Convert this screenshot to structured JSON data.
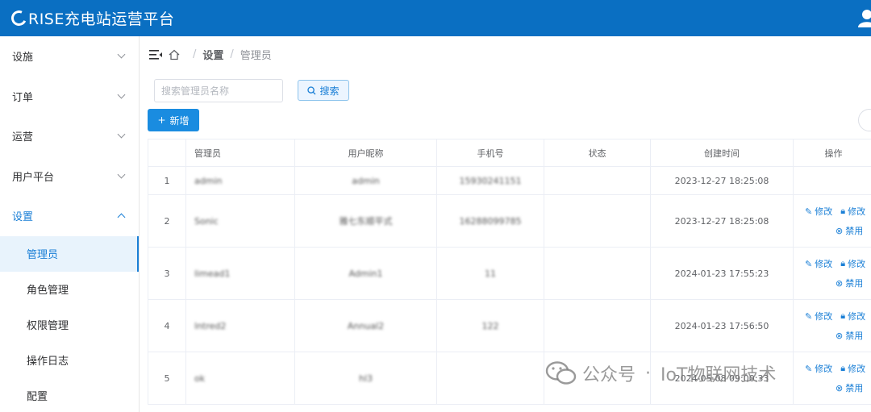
{
  "header": {
    "brand": "RISE充电站运营平台"
  },
  "sidebar": {
    "menus": [
      {
        "label": "设施"
      },
      {
        "label": "订单"
      },
      {
        "label": "运营"
      },
      {
        "label": "用户平台"
      },
      {
        "label": "设置"
      }
    ],
    "settings_children": [
      {
        "label": "管理员"
      },
      {
        "label": "角色管理"
      },
      {
        "label": "权限管理"
      },
      {
        "label": "操作日志"
      },
      {
        "label": "配置"
      }
    ]
  },
  "breadcrumb": {
    "level1": "设置",
    "level2": "管理员",
    "sep": "/"
  },
  "toolbar": {
    "search_placeholder": "搜索管理员名称",
    "search_label": "搜索",
    "add_label": "新增"
  },
  "table": {
    "headers": [
      "",
      "管理员",
      "用户昵称",
      "手机号",
      "状态",
      "创建时间",
      "操作"
    ],
    "rows": [
      {
        "index": "1",
        "admin": "admin",
        "nickname": "admin",
        "phone": "15930241151",
        "status": "",
        "created": "2023-12-27 18:25:08",
        "ops": false
      },
      {
        "index": "2",
        "admin": "Sonic",
        "nickname": "雅七东顺平式",
        "phone": "16288099785",
        "status": "",
        "created": "2023-12-27 18:25:08",
        "ops": true
      },
      {
        "index": "3",
        "admin": "limead1",
        "nickname": "Admin1",
        "phone": "11",
        "status": "",
        "created": "2024-01-23 17:55:23",
        "ops": true
      },
      {
        "index": "4",
        "admin": "lntred2",
        "nickname": "Annual2",
        "phone": "122",
        "status": "",
        "created": "2024-01-23 17:56:50",
        "ops": true
      },
      {
        "index": "5",
        "admin": "ok",
        "nickname": "hl3",
        "phone": "",
        "status": "",
        "created": "2024-05-08 09:00:33",
        "ops": true
      }
    ],
    "op_edit": "修改",
    "op_edit2": "修改",
    "op_disable": "禁用"
  },
  "watermark": {
    "text1": "公众号",
    "dot": "·",
    "text2": "IoT物联网技术"
  },
  "colors": {
    "header_bg": "#0a6fc2",
    "accent": "#1a7fd6",
    "active_bg": "#e8f3fc"
  }
}
